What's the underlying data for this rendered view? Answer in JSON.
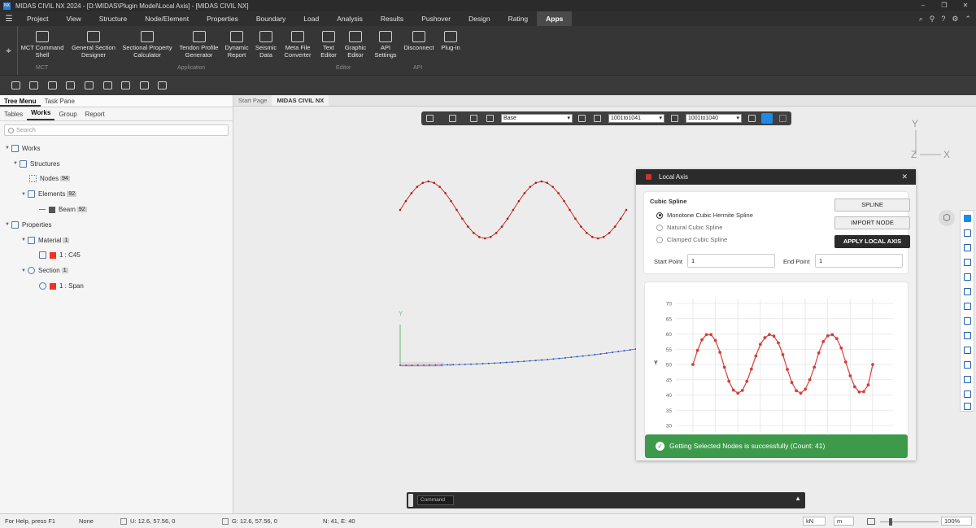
{
  "window": {
    "title": "MIDAS CIVIL NX 2024 - [D:\\MIDAS\\Plugin Model\\Local Axis] - [MIDAS CIVIL NX]",
    "logo": "NX"
  },
  "menu": [
    "Project",
    "View",
    "Structure",
    "Node/Element",
    "Properties",
    "Boundary",
    "Load",
    "Analysis",
    "Results",
    "Pushover",
    "Design",
    "Rating",
    "Apps"
  ],
  "menu_active": "Apps",
  "ribbon": {
    "buttons": [
      {
        "label1": "MCT Command",
        "label2": "Shell"
      },
      {
        "label1": "General Section",
        "label2": "Designer"
      },
      {
        "label1": "Sectional Property",
        "label2": "Calculator"
      },
      {
        "label1": "Tendon Profile",
        "label2": "Generator"
      },
      {
        "label1": "Dynamic",
        "label2": "Report"
      },
      {
        "label1": "Seismic",
        "label2": "Data"
      },
      {
        "label1": "Meta File",
        "label2": "Converter"
      },
      {
        "label1": "Text",
        "label2": "Editor"
      },
      {
        "label1": "Graphic",
        "label2": "Editor"
      },
      {
        "label1": "API",
        "label2": "Settings"
      },
      {
        "label1": "Disconnect",
        "label2": ""
      },
      {
        "label1": "Plug-in",
        "label2": ""
      }
    ],
    "groups": [
      "MCT",
      "Application",
      "Editor",
      "API"
    ]
  },
  "left_panel": {
    "tabs": [
      "Tree Menu",
      "Task Pane"
    ],
    "subtabs": [
      "Tables",
      "Works",
      "Group",
      "Report"
    ],
    "search_placeholder": "Search",
    "tree": [
      {
        "label": "Works",
        "badge": ""
      },
      {
        "label": "Structures",
        "badge": ""
      },
      {
        "label": "Nodes",
        "badge": "94"
      },
      {
        "label": "Elements",
        "badge": "92"
      },
      {
        "label": "Beam",
        "badge": "92"
      },
      {
        "label": "Properties",
        "badge": ""
      },
      {
        "label": "Material",
        "badge": "1"
      },
      {
        "label": "1 : C45",
        "badge": ""
      },
      {
        "label": "Section",
        "badge": "1"
      },
      {
        "label": "1 : Span",
        "badge": ""
      }
    ]
  },
  "viewport": {
    "tabs": [
      "Start Page",
      "MIDAS CIVIL NX"
    ],
    "toolbar": {
      "select1": "Base",
      "select2": "1001to1041",
      "select3": "1001to1040"
    },
    "axis": {
      "y": "Y",
      "z": "Z",
      "x": "X"
    }
  },
  "dialog": {
    "title": "Local Axis",
    "section_title": "Cubic Spline",
    "options": [
      "Monotone Cubic Hermite Spline",
      "Natural Cubic Spline",
      "Clamped Cubic Spline"
    ],
    "selected": "Monotone Cubic Hermite Spline",
    "buttons": {
      "spline": "SPLINE",
      "import": "IMPORT NODE",
      "apply": "APPLY LOCAL AXIS"
    },
    "start_label": "Start Point",
    "start_value": "1",
    "end_label": "End Point",
    "end_value": "1"
  },
  "chart_data": {
    "type": "line",
    "ylabel": "Y",
    "ylim": [
      30,
      70
    ],
    "yticks": [
      30,
      35,
      40,
      45,
      50,
      55,
      60,
      65,
      70
    ],
    "point_count": 41,
    "y": [
      50,
      54.6,
      58.1,
      59.8,
      59.8,
      57.9,
      54.0,
      49.1,
      44.5,
      41.6,
      40.6,
      41.5,
      44.5,
      48.5,
      52.8,
      56.6,
      58.8,
      59.8,
      59.3,
      57.1,
      53.2,
      48.4,
      44.1,
      41.4,
      40.6,
      41.9,
      45.0,
      49.1,
      53.8,
      57.5,
      59.4,
      59.8,
      58.5,
      55.4,
      50.8,
      46.3,
      42.7,
      41.0,
      41.1,
      43.3,
      50.0
    ],
    "color": "#d43f3a"
  },
  "toast": {
    "message": "Getting Selected Nodes is successfully (Count: 41)"
  },
  "command": {
    "label": "Command"
  },
  "status": {
    "help": "For Help, press F1",
    "none": "None",
    "u": "U: 12.6, 57.56, 0",
    "g": "G: 12.6, 57.56, 0",
    "ne": "N: 41, E: 40",
    "force": "kN",
    "length": "m",
    "zoom": "100%"
  }
}
